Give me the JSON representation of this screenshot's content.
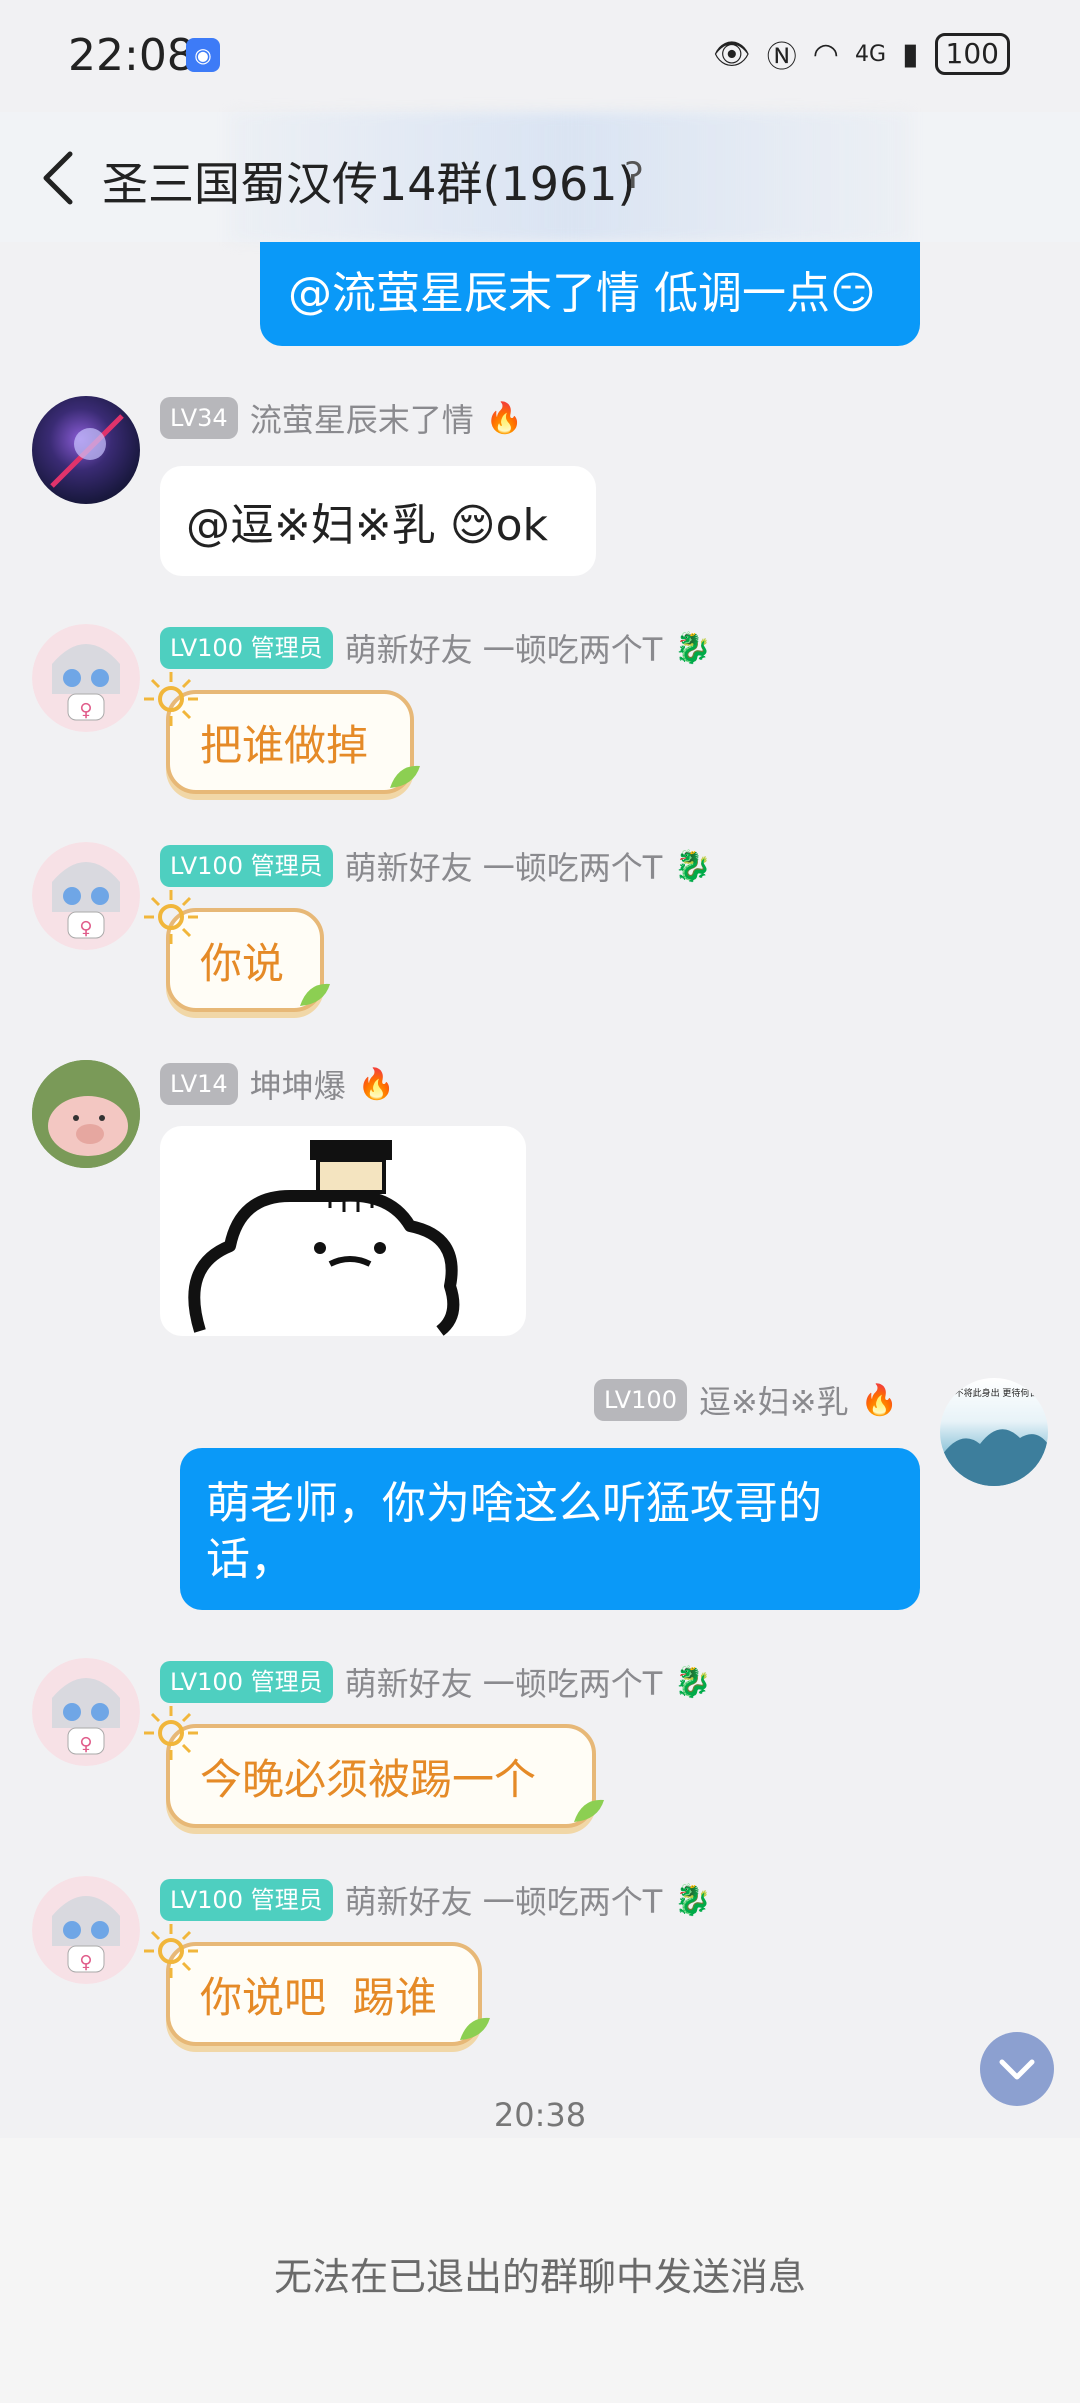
{
  "status_bar": {
    "time": "22:08",
    "battery": "100",
    "network": "4G"
  },
  "header": {
    "title": "圣三国蜀汉传14群(1961)"
  },
  "messages": [
    {
      "kind": "outgoing",
      "text": "@流萤星辰末了情 低调一点😏"
    },
    {
      "kind": "incoming",
      "level": "LV34",
      "nick": "流萤星辰末了情",
      "text": "@逗※妇※乳 😌ok"
    },
    {
      "kind": "incoming",
      "level": "LV100",
      "role": "管理员",
      "nick": "萌新好友 一顿吃两个T",
      "text": "把谁做掉"
    },
    {
      "kind": "incoming",
      "level": "LV100",
      "role": "管理员",
      "nick": "萌新好友 一顿吃两个T",
      "text": "你说"
    },
    {
      "kind": "incoming",
      "level": "LV14",
      "nick": "坤坤爆",
      "sticker": true
    },
    {
      "kind": "outgoing",
      "level": "LV100",
      "nick": "逗※妇※乳",
      "text": "萌老师，你为啥这么听猛攻哥的话，",
      "avatar_text": "不将此身出 更待何日度此身"
    },
    {
      "kind": "incoming",
      "level": "LV100",
      "role": "管理员",
      "nick": "萌新好友 一顿吃两个T",
      "text": "今晚必须被踢一个"
    },
    {
      "kind": "incoming",
      "level": "LV100",
      "role": "管理员",
      "nick": "萌新好友 一顿吃两个T",
      "text": "你说吧  踢谁"
    }
  ],
  "timestamp": "20:38",
  "footer": {
    "notice": "无法在已退出的群聊中发送消息"
  },
  "colors": {
    "bubble_blue": "#0a99f8",
    "admin_badge": "#4ecfc0",
    "sun_text": "#e58a27"
  }
}
